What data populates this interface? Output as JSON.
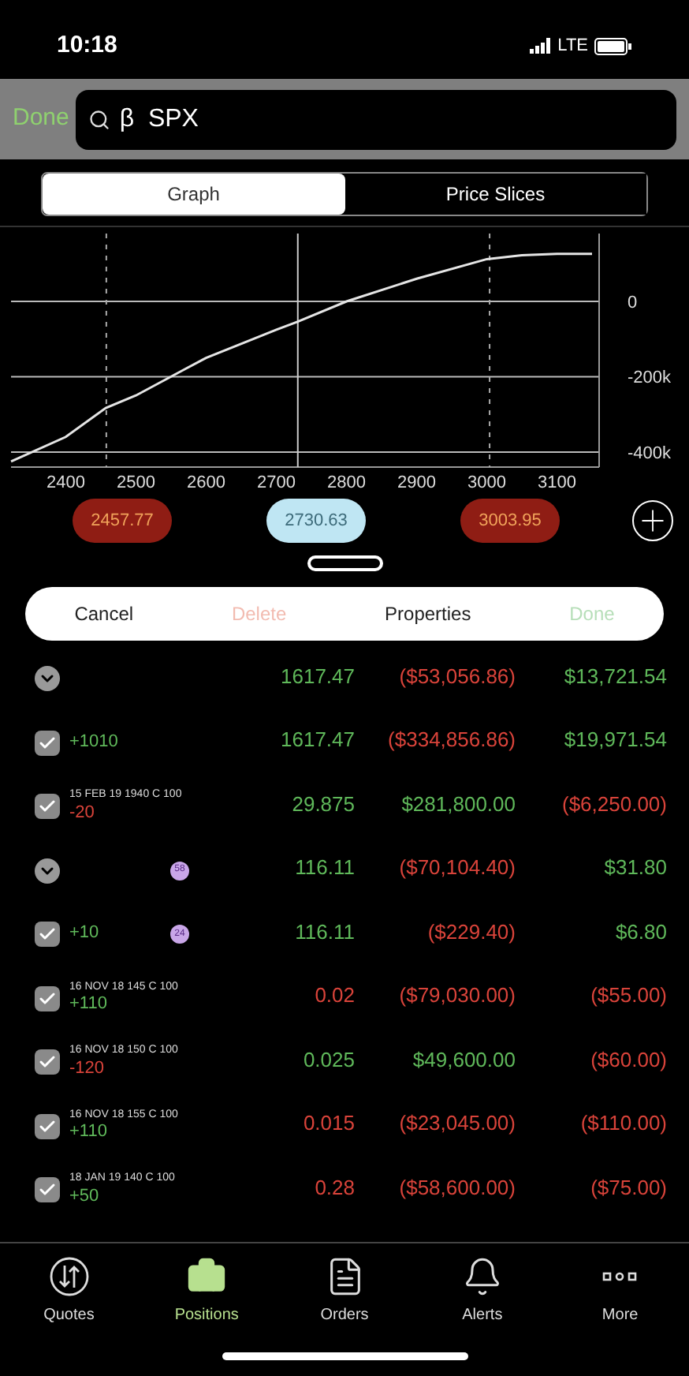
{
  "status_bar": {
    "time": "10:18",
    "network": "LTE"
  },
  "search": {
    "done": "Done",
    "value": "β  SPX"
  },
  "segments": [
    {
      "label": "Graph",
      "selected": true
    },
    {
      "label": "Price Slices",
      "selected": false
    }
  ],
  "chart": {
    "chart_data": {
      "type": "line",
      "x": [
        2322,
        2400,
        2457,
        2500,
        2570,
        2600,
        2700,
        2730,
        2800,
        2900,
        3000,
        3050,
        3100,
        3150
      ],
      "series": [
        {
          "color": "#e5e5e5",
          "values": [
            -425000,
            -360000,
            -283000,
            -250000,
            -180000,
            -150000,
            -75000,
            -54000,
            0,
            60000,
            112000,
            122000,
            126000,
            126000
          ]
        }
      ],
      "xlim": [
        2322,
        3160
      ],
      "ylim": [
        -440000,
        180000
      ],
      "grid": true,
      "ref_lines": [
        {
          "axis": "x",
          "value": 2457.77
        },
        {
          "axis": "x",
          "value": 2730.63
        },
        {
          "axis": "x",
          "value": 3003.95
        }
      ],
      "xticks": [
        2400,
        2500,
        2600,
        2700,
        2800,
        2900,
        3000,
        3100
      ],
      "yticks": [
        {
          "value": 0,
          "label": "0"
        },
        {
          "value": -200000,
          "label": "-200k"
        },
        {
          "value": -400000,
          "label": "-400k"
        }
      ]
    },
    "markers": [
      {
        "label": "2457.77",
        "kind": "breakeven"
      },
      {
        "label": "2730.63",
        "kind": "current"
      },
      {
        "label": "3003.95",
        "kind": "breakeven"
      }
    ]
  },
  "actions": [
    {
      "label": "Cancel",
      "kind": "cancel",
      "disabled": false
    },
    {
      "label": "Delete",
      "kind": "destructive",
      "disabled": true
    },
    {
      "label": "Properties",
      "kind": "plain",
      "disabled": false
    },
    {
      "label": "Done",
      "kind": "confirm",
      "disabled": true
    }
  ],
  "positions": [
    {
      "kind": "group",
      "values": [
        {
          "text": "1617.47",
          "positive": true
        },
        {
          "text": "($53,056.86)",
          "positive": false
        },
        {
          "text": "$13,721.54",
          "positive": true
        }
      ]
    },
    {
      "kind": "leg",
      "checked": true,
      "quantity": {
        "text": "+1010",
        "positive": true
      },
      "values": [
        {
          "text": "1617.47",
          "positive": true
        },
        {
          "text": "($334,856.86)",
          "positive": false
        },
        {
          "text": "$19,971.54",
          "positive": true
        }
      ]
    },
    {
      "kind": "leg",
      "checked": true,
      "name": "15 FEB 19 1940 C 100",
      "quantity": {
        "text": "-20",
        "positive": false
      },
      "values": [
        {
          "text": "29.875",
          "positive": true
        },
        {
          "text": "$281,800.00",
          "positive": true
        },
        {
          "text": "($6,250.00)",
          "positive": false
        }
      ]
    },
    {
      "kind": "group",
      "badge": "58",
      "values": [
        {
          "text": "116.11",
          "positive": true
        },
        {
          "text": "($70,104.40)",
          "positive": false
        },
        {
          "text": "$31.80",
          "positive": true
        }
      ]
    },
    {
      "kind": "leg",
      "checked": true,
      "badge": "24",
      "quantity": {
        "text": "+10",
        "positive": true
      },
      "values": [
        {
          "text": "116.11",
          "positive": true
        },
        {
          "text": "($229.40)",
          "positive": false
        },
        {
          "text": "$6.80",
          "positive": true
        }
      ]
    },
    {
      "kind": "leg",
      "checked": true,
      "name": "16 NOV 18 145 C 100",
      "quantity": {
        "text": "+110",
        "positive": true
      },
      "values": [
        {
          "text": "0.02",
          "positive": false
        },
        {
          "text": "($79,030.00)",
          "positive": false
        },
        {
          "text": "($55.00)",
          "positive": false
        }
      ]
    },
    {
      "kind": "leg",
      "checked": true,
      "name": "16 NOV 18 150 C 100",
      "quantity": {
        "text": "-120",
        "positive": false
      },
      "values": [
        {
          "text": "0.025",
          "positive": true
        },
        {
          "text": "$49,600.00",
          "positive": true
        },
        {
          "text": "($60.00)",
          "positive": false
        }
      ]
    },
    {
      "kind": "leg",
      "checked": true,
      "name": "16 NOV 18 155 C 100",
      "quantity": {
        "text": "+110",
        "positive": true
      },
      "values": [
        {
          "text": "0.015",
          "positive": false
        },
        {
          "text": "($23,045.00)",
          "positive": false
        },
        {
          "text": "($110.00)",
          "positive": false
        }
      ]
    },
    {
      "kind": "leg",
      "checked": true,
      "name": "18 JAN 19 140 C 100",
      "quantity": {
        "text": "+50",
        "positive": true
      },
      "values": [
        {
          "text": "0.28",
          "positive": false
        },
        {
          "text": "($58,600.00)",
          "positive": false
        },
        {
          "text": "($75.00)",
          "positive": false
        }
      ]
    }
  ],
  "tab_bar": [
    {
      "label": "Quotes",
      "selected": false
    },
    {
      "label": "Positions",
      "selected": true
    },
    {
      "label": "Orders",
      "selected": false
    },
    {
      "label": "Alerts",
      "selected": false
    },
    {
      "label": "More",
      "selected": false
    }
  ]
}
